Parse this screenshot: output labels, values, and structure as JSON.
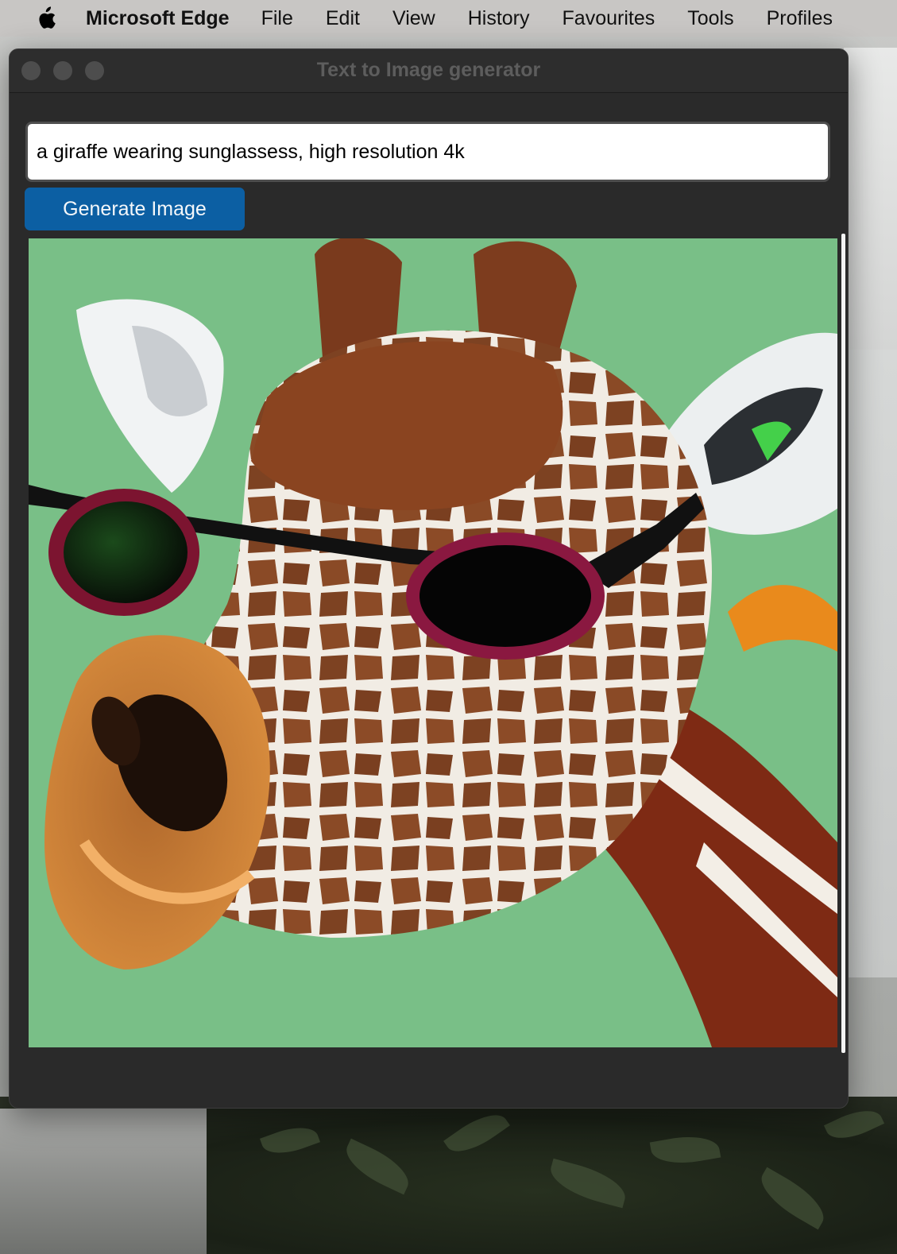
{
  "menubar": {
    "apple_icon": "apple-logo-icon",
    "app_name": "Microsoft Edge",
    "items": [
      "File",
      "Edit",
      "View",
      "History",
      "Favourites",
      "Tools",
      "Profiles"
    ]
  },
  "window": {
    "title": "Text to Image generator",
    "controls": [
      "close",
      "minimize",
      "zoom"
    ]
  },
  "prompt": {
    "value": "a giraffe wearing sunglassess, high resolution 4k"
  },
  "generate_button": {
    "label": "Generate Image"
  },
  "generated_image": {
    "subject": "giraffe wearing sunglasses",
    "background_color": "#79bf87"
  },
  "colors": {
    "accent": "#0c5fa3",
    "window_bg": "#2a2a2a",
    "titlebar_text": "#5d5d5d"
  }
}
